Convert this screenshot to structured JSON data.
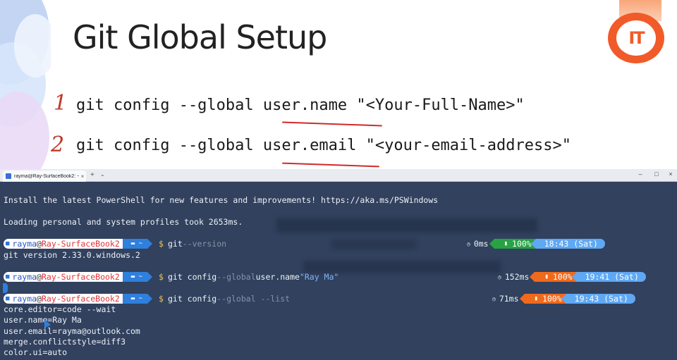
{
  "slide": {
    "title": "Git Global Setup",
    "step1_marker": "1",
    "step2_marker": "2",
    "command1": "git config --global user.name \"<Your-Full-Name>\"",
    "command2": "git config --global user.email \"<your-email-address>\"",
    "logo_text": "IT",
    "colors": {
      "accent": "#f15a29",
      "underline": "#d02a2a"
    }
  },
  "terminal": {
    "tab_title": "rayma@Ray-SurfaceBook2: ~",
    "tab_close": "×",
    "new_tab": "+",
    "tab_dropdown": "⌄",
    "window_controls": {
      "minimize": "–",
      "maximize": "□",
      "close": "×"
    },
    "banner": "Install the latest PowerShell for new features and improvements! https://aka.ms/PSWindows",
    "profile_msg": "Loading personal and system profiles took 2653ms.",
    "prompt": {
      "user": "rayma",
      "at": "@",
      "host": "Ray-SurfaceBook2",
      "path": "~",
      "symbol": "$"
    },
    "entries": [
      {
        "cmd": "git",
        "flag": " --version",
        "arg": "",
        "str": "",
        "duration": "0ms",
        "battery": "100%",
        "battery_state": "charging",
        "time": "18:43 (Sat)"
      },
      {
        "cmd": "git config",
        "flag": " --global",
        "arg": " user.name ",
        "str": "\"Ray Ma\"",
        "duration": "152ms",
        "battery": "100%",
        "battery_state": "plugged",
        "time": "19:41 (Sat)"
      },
      {
        "cmd": "git config",
        "flag": " --global --list",
        "arg": "",
        "str": "",
        "duration": "71ms",
        "battery": "100%",
        "battery_state": "plugged",
        "time": "19:43 (Sat)"
      }
    ],
    "output_version": "git version 2.33.0.windows.2",
    "config_list": [
      "core.editor=code --wait",
      "user.name=Ray Ma",
      "user.email=rayma@outlook.com",
      "merge.conflictstyle=diff3",
      "color.ui=auto"
    ],
    "colors": {
      "background": "#31415e",
      "path_segment": "#2f7fdd",
      "battery_charging": "#27a244",
      "battery_plugged": "#f06a1c",
      "clock": "#5fa8f4"
    }
  }
}
